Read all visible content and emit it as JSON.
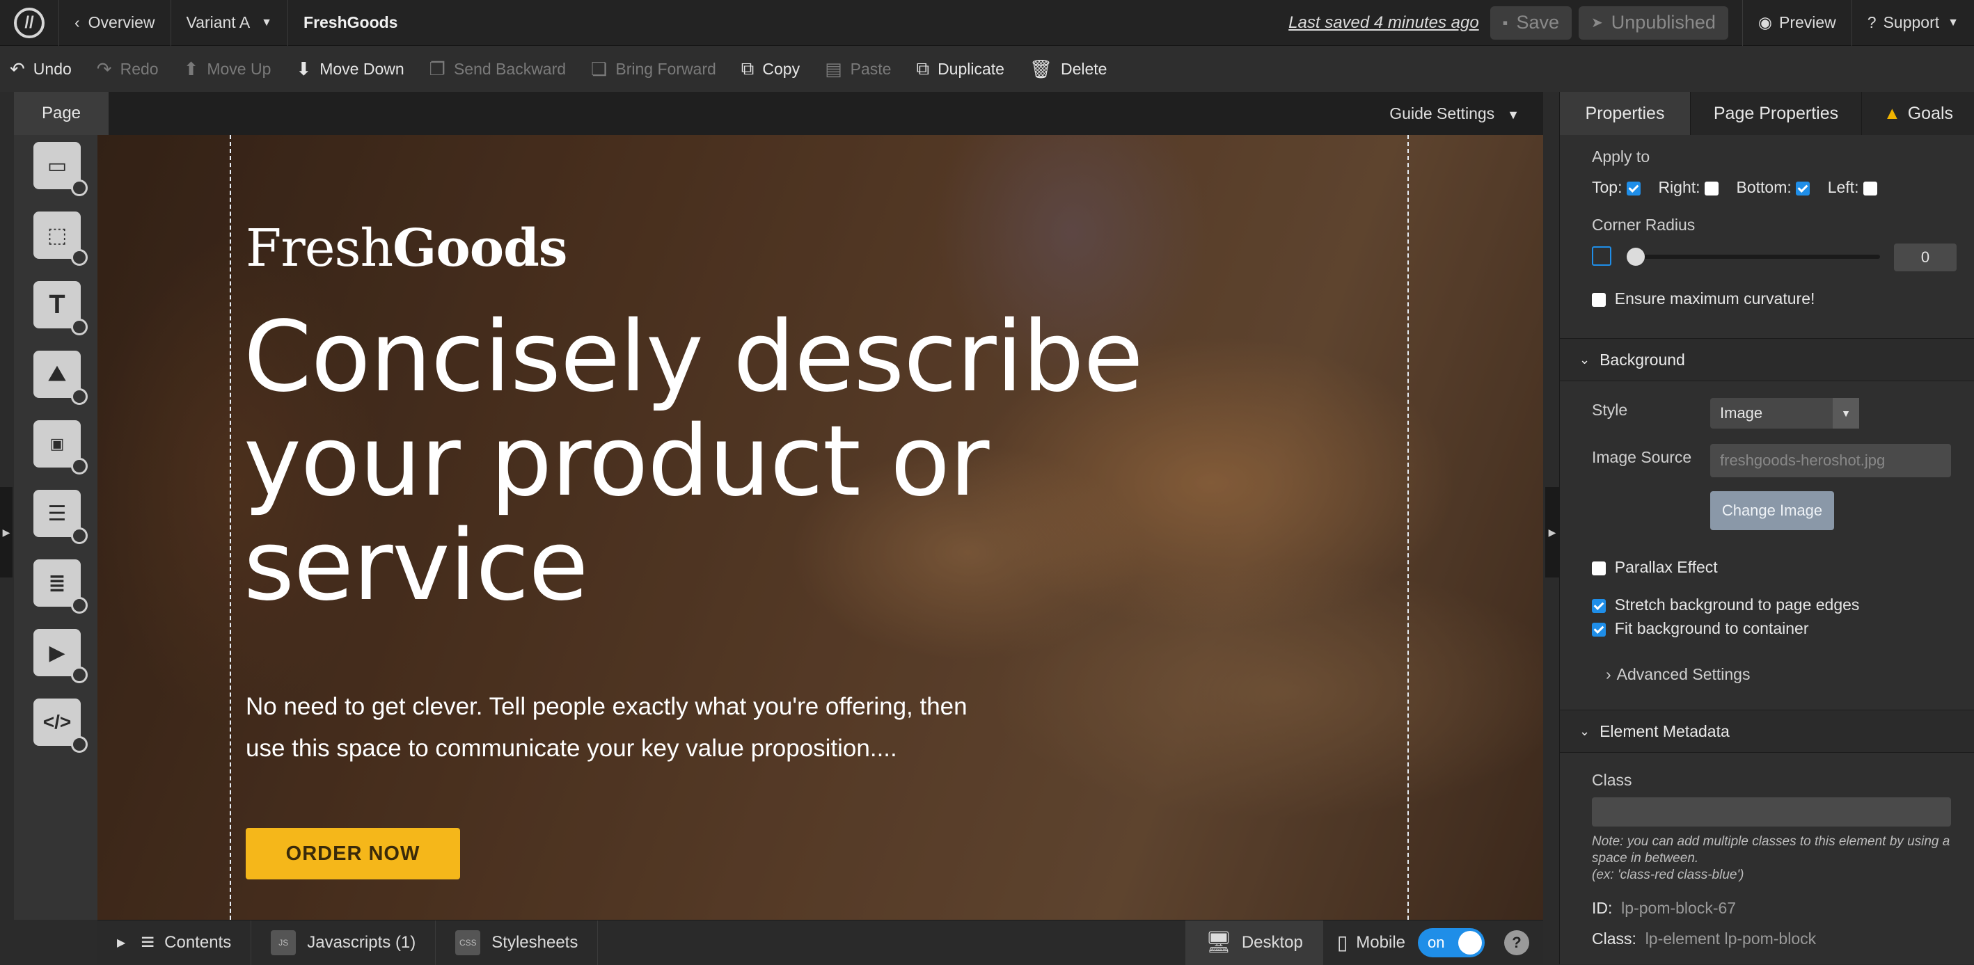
{
  "topbar": {
    "overview": "Overview",
    "variant": "Variant A",
    "page_name": "FreshGoods",
    "last_saved": "Last saved  4 minutes ago",
    "save": "Save",
    "unpublished": "Unpublished",
    "preview": "Preview",
    "support": "Support"
  },
  "toolbar": {
    "undo": "Undo",
    "redo": "Redo",
    "move_up": "Move Up",
    "move_down": "Move Down",
    "send_backward": "Send Backward",
    "bring_forward": "Bring Forward",
    "copy": "Copy",
    "paste": "Paste",
    "duplicate": "Duplicate",
    "delete": "Delete"
  },
  "canvas": {
    "page_tab": "Page",
    "guide_settings": "Guide Settings",
    "logo_light": "Fresh",
    "logo_bold": "Goods",
    "headline": "Concisely describe your product or service",
    "subcopy": "No need to get clever. Tell people exactly what you're offering, then use this space to communicate your key value proposition....",
    "cta": "ORDER NOW"
  },
  "bottombar": {
    "contents": "Contents",
    "javascripts": "Javascripts",
    "js_count": "(1)",
    "stylesheets": "Stylesheets",
    "desktop": "Desktop",
    "mobile": "Mobile",
    "toggle_label": "on",
    "help": "?",
    "js_icon": "JS",
    "css_icon": "CSS"
  },
  "panel": {
    "tabs": [
      "Properties",
      "Page Properties",
      "Goals"
    ],
    "apply_to": "Apply to",
    "top": "Top:",
    "right": "Right:",
    "bottom": "Bottom:",
    "left": "Left:",
    "corner_radius": "Corner Radius",
    "corner_value": "0",
    "max_curvature": "Ensure maximum curvature!",
    "background": "Background",
    "style_label": "Style",
    "style_value": "Image",
    "image_source_label": "Image Source",
    "image_source_value": "freshgoods-heroshot.jpg",
    "change_image": "Change Image",
    "parallax": "Parallax Effect",
    "stretch": "Stretch background to page edges",
    "fit": "Fit background to container",
    "advanced": "Advanced Settings",
    "metadata": "Element Metadata",
    "class_label": "Class",
    "note": "Note: you can add multiple classes to this element by using a space in between.",
    "note_example": "(ex: 'class-red class-blue')",
    "id_label": "ID:",
    "id_value": "lp-pom-block-67",
    "class_label2": "Class:",
    "class_value": "lp-element lp-pom-block"
  },
  "colors": {
    "accent": "#1f8ee8",
    "cta": "#f5b71a",
    "warning": "#f0b400"
  }
}
